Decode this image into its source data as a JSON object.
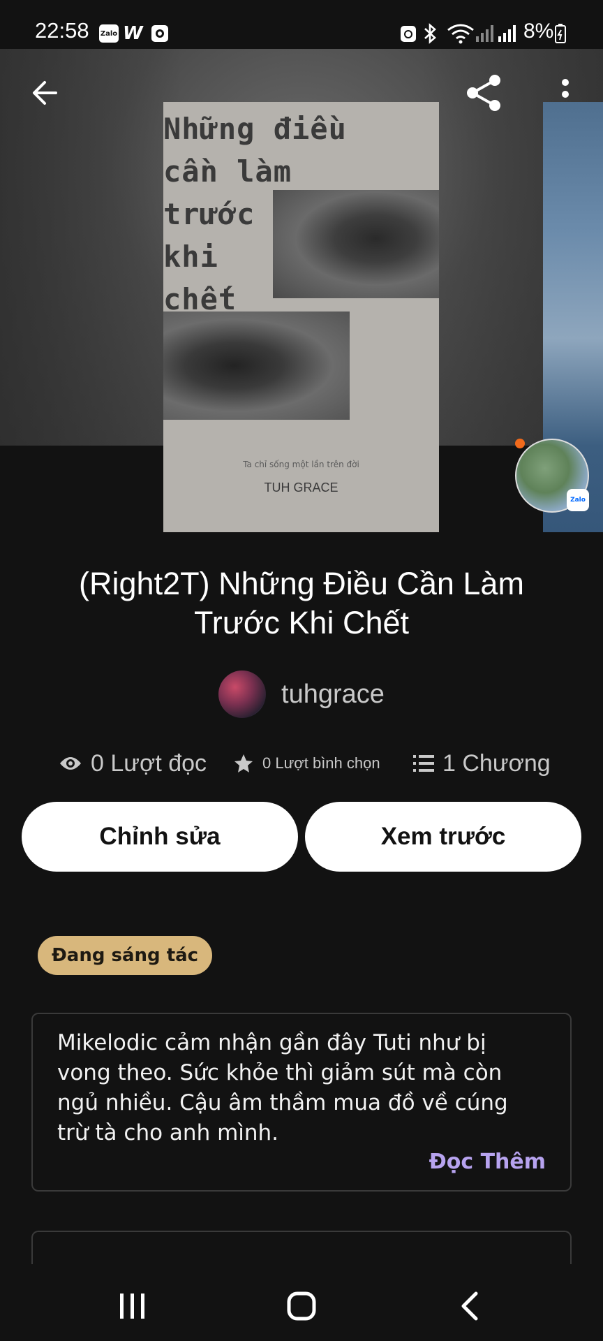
{
  "status_bar": {
    "time": "22:58",
    "notif_icons": [
      "zalo-icon",
      "wattpad-icon",
      "camera-app-icon"
    ],
    "zalo_label": "Zalo",
    "wattpad_label": "W",
    "battery": "8%"
  },
  "header": {
    "back_icon": "arrow-left-icon",
    "share_icon": "share-icon",
    "more_icon": "more-vertical-icon"
  },
  "cover": {
    "title_text": "Những điều\ncần làm\ntrước\nkhi\nchết",
    "subtitle": "Ta chỉ sống một lần trên đời",
    "author": "TUH GRACE"
  },
  "bubble": {
    "badge": "Zalo"
  },
  "book": {
    "title": "(Right2T) Những Điều Cần Làm Trước Khi Chết",
    "author": "tuhgrace"
  },
  "stats": {
    "reads": "0 Lượt đọc",
    "votes": "0 Lượt bình chọn",
    "chapters": "1 Chương"
  },
  "actions": {
    "edit": "Chỉnh sửa",
    "preview": "Xem trước"
  },
  "status_badge": "Đang sáng tác",
  "description": {
    "text": "Mikelodic cảm nhận gần đây Tuti như bị vong theo. Sức khỏe thì giảm sút mà còn ngủ nhiều. Cậu âm thầm mua đồ về cúng trừ tà cho anh mình.",
    "read_more": "Đọc Thêm"
  },
  "colors": {
    "background": "#121212",
    "badge": "#d8b77c",
    "read_more": "#b7a3ef"
  }
}
